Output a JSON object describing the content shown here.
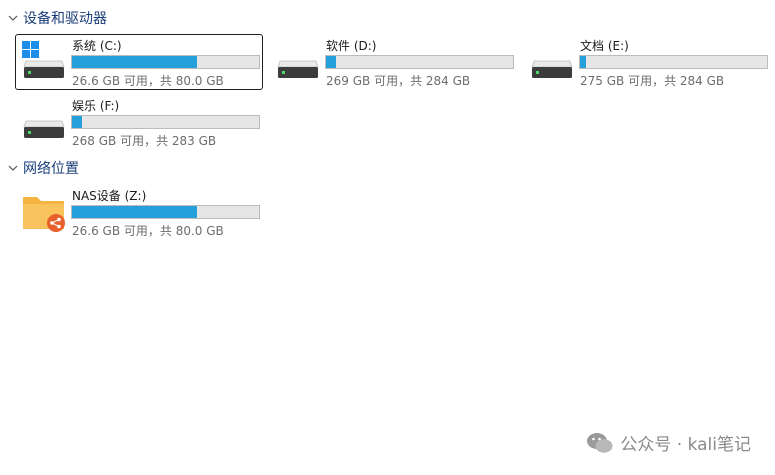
{
  "sections": [
    {
      "title": "设备和驱动器"
    },
    {
      "title": "网络位置"
    }
  ],
  "drives": [
    {
      "name": "系统 (C:)",
      "free_text": "26.6 GB 可用，共 80.0 GB",
      "used_fraction": 0.6675,
      "icon": "windows-system-drive-icon"
    },
    {
      "name": "软件 (D:)",
      "free_text": "269 GB 可用，共 284 GB",
      "used_fraction": 0.053,
      "icon": "hard-drive-icon"
    },
    {
      "name": "文档 (E:)",
      "free_text": "275 GB 可用，共 284 GB",
      "used_fraction": 0.032,
      "icon": "hard-drive-icon"
    },
    {
      "name": "娱乐 (F:)",
      "free_text": "268 GB 可用，共 283 GB",
      "used_fraction": 0.053,
      "icon": "hard-drive-icon"
    }
  ],
  "network": [
    {
      "name": "NAS设备 (Z:)",
      "free_text": "26.6 GB 可用，共 80.0 GB",
      "used_fraction": 0.6675,
      "icon": "network-folder-icon"
    }
  ],
  "watermark": {
    "text": "公众号 · kali笔记",
    "icon": "wechat-icon"
  },
  "colors": {
    "bar_fill": "#26a0da",
    "bar_track": "#e6e6e6",
    "section_title": "#1a3e7a",
    "folder": "#f5b342",
    "share_badge": "#e8612c"
  }
}
